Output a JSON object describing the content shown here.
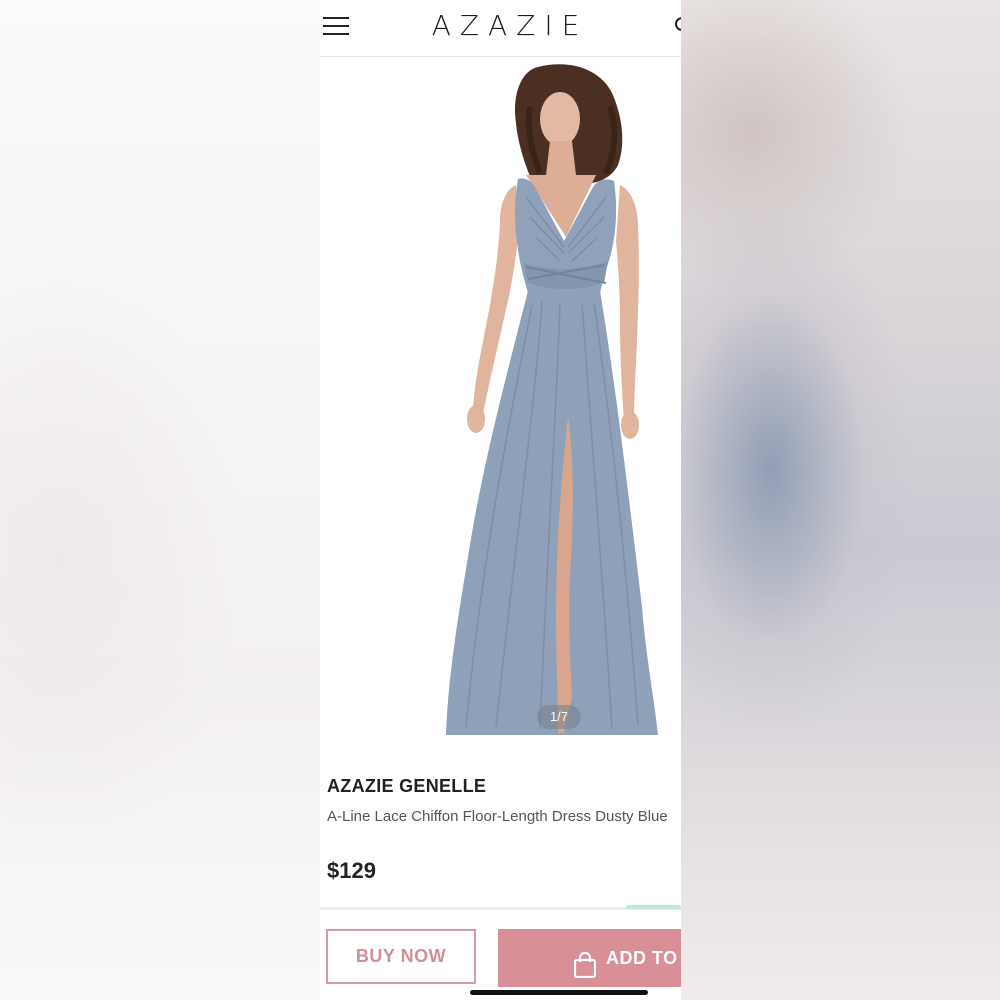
{
  "header": {
    "logo": "AZAZIE",
    "menu_icon": "hamburger-menu-icon",
    "search_icon": "search-icon"
  },
  "gallery": {
    "counter": "1/7",
    "dress_color": "#8ea1b8"
  },
  "product": {
    "brand": "AZAZIE GENELLE",
    "description": "A-Line Lace Chiffon Floor-Length Dress Dusty Blue",
    "price": "$129"
  },
  "actions": {
    "buy_now": "BUY NOW",
    "add_to_bag": "ADD TO",
    "bag_icon": "shopping-bag-icon",
    "accent_color": "#d98f98"
  }
}
